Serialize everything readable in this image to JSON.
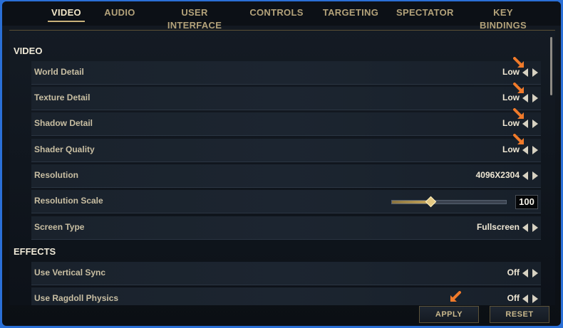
{
  "tabs": [
    {
      "label": "VIDEO",
      "active": true
    },
    {
      "label": "AUDIO",
      "active": false
    },
    {
      "label": "USER INTERFACE",
      "active": false
    },
    {
      "label": "CONTROLS",
      "active": false
    },
    {
      "label": "TARGETING",
      "active": false
    },
    {
      "label": "SPECTATOR",
      "active": false
    },
    {
      "label": "KEY BINDINGS",
      "active": false
    }
  ],
  "sections": {
    "video": "VIDEO",
    "effects": "EFFECTS"
  },
  "video_settings": [
    {
      "label": "World Detail",
      "value": "Low"
    },
    {
      "label": "Texture Detail",
      "value": "Low"
    },
    {
      "label": "Shadow Detail",
      "value": "Low"
    },
    {
      "label": "Shader Quality",
      "value": "Low"
    },
    {
      "label": "Resolution",
      "value": "4096X2304"
    },
    {
      "label": "Resolution Scale",
      "value": "100",
      "slider_fraction": 0.34
    },
    {
      "label": "Screen Type",
      "value": "Fullscreen"
    }
  ],
  "effects_settings": [
    {
      "label": "Use Vertical Sync",
      "value": "Off"
    },
    {
      "label": "Use Ragdoll Physics",
      "value": "Off"
    }
  ],
  "buttons": {
    "apply": "APPLY",
    "reset": "RESET"
  },
  "colors": {
    "highlight_arrow": "#f07a2a",
    "accent_gold": "#c9b27a",
    "background_border": "#2a6fd6"
  },
  "icons": {
    "decrease": "chevron-left-icon",
    "increase": "chevron-right-icon",
    "annotation": "orange-pointer-arrow-icon"
  }
}
